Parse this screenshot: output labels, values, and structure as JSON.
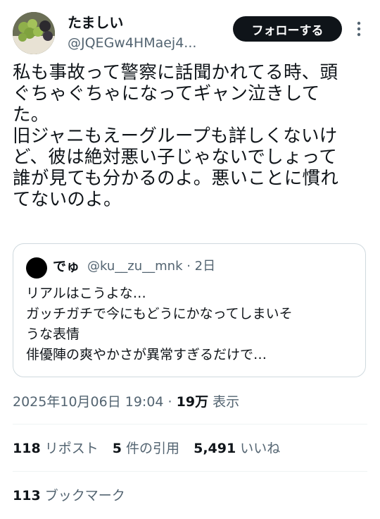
{
  "author": {
    "display_name": "たましい",
    "handle": "@JQEGw4HMaej4..."
  },
  "follow_label": "フォローする",
  "tweet_text": "私も事故って警察に話聞かれてる時、頭\nぐちゃぐちゃになってギャン泣きして\nた。\n旧ジャニもえーグループも詳しくないけ\nど、彼は絶対悪い子じゃないでしょって\n誰が見ても分かるのよ。悪いことに慣れ\nてないのよ。",
  "quote": {
    "display_name": "でゅ",
    "handle_time": "@ku__zu__mnk · 2日",
    "text": "リアルはこうよな…\nガッチガチで今にもどうにかなってしまいそ\nうな表情\n俳優陣の爽やかさが異常すぎるだけで…"
  },
  "meta": {
    "datetime": "2025年10月06日 19:04 · ",
    "views_count": "19万",
    "views_label": " 表示"
  },
  "stats": {
    "retweets_count": "118",
    "retweets_label": " リポスト",
    "quotes_count": "5",
    "quotes_label": " 件の引用",
    "likes_count": "5,491",
    "likes_label": " いいね"
  },
  "bookmarks": {
    "count": "113",
    "label": " ブックマーク"
  },
  "icons": {
    "more": "more-vertical-icon"
  }
}
